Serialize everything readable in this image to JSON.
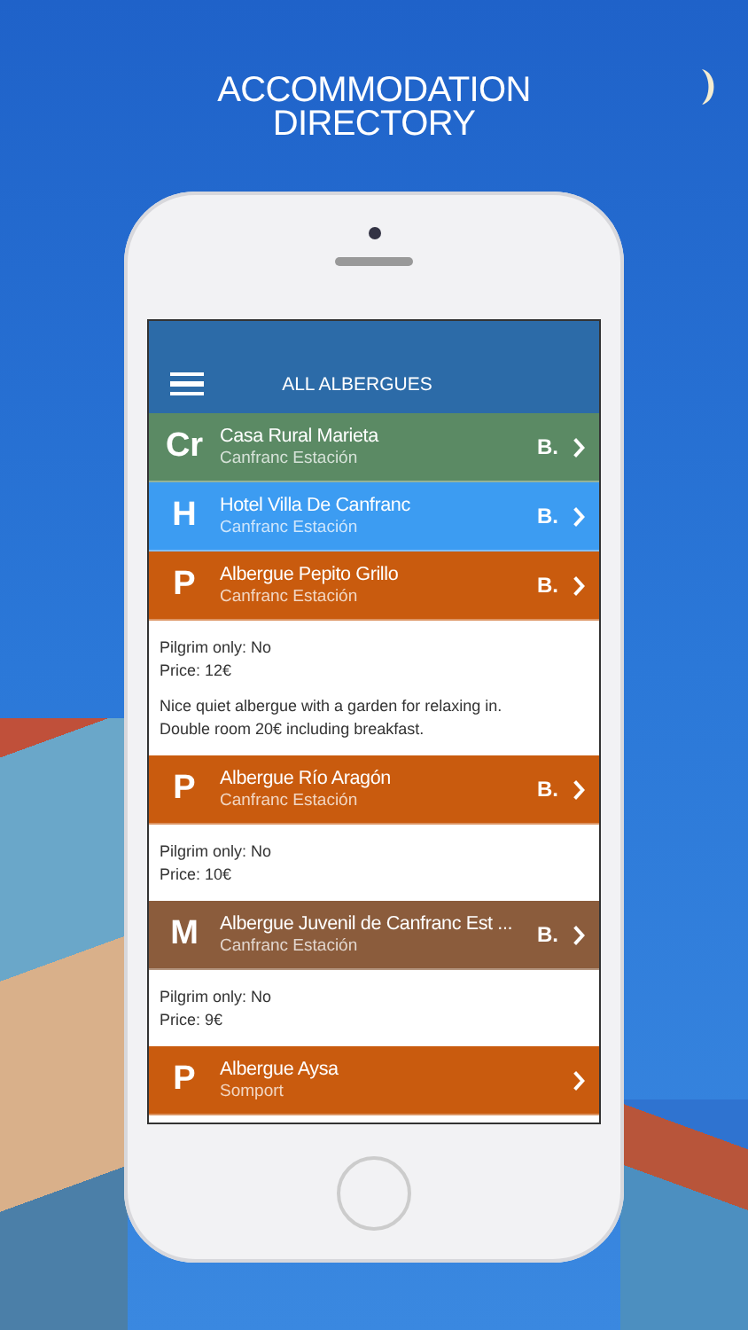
{
  "headline": [
    "ACCOMMODATION",
    "DIRECTORY"
  ],
  "app": {
    "title": "ALL ALBERGUES",
    "items": [
      {
        "badge": "Cr",
        "name": "Casa Rural Marieta",
        "place": "Canfranc Estación",
        "booking": "B.",
        "color": "#5b8a64"
      },
      {
        "badge": "H",
        "name": "Hotel Villa De Canfranc",
        "place": "Canfranc Estación",
        "booking": "B.",
        "color": "#3c9cf2"
      },
      {
        "badge": "P",
        "name": "Albergue Pepito Grillo",
        "place": "Canfranc Estación",
        "booking": "B.",
        "color": "#c95b0e",
        "details": [
          "Pilgrim only: No",
          "Price: 12€"
        ],
        "description": "Nice quiet albergue with a garden for relaxing in. Double room 20€ including breakfast."
      },
      {
        "badge": "P",
        "name": "Albergue Río Aragón",
        "place": "Canfranc Estación",
        "booking": "B.",
        "color": "#c95b0e",
        "details": [
          "Pilgrim only: No",
          "Price: 10€"
        ]
      },
      {
        "badge": "M",
        "name": "Albergue Juvenil de Canfranc Est ...",
        "place": "Canfranc Estación",
        "booking": "B.",
        "color": "#8b5c3c",
        "details": [
          "Pilgrim only: No",
          "Price: 9€"
        ]
      },
      {
        "badge": "P",
        "name": "Albergue Aysa",
        "place": "Somport",
        "color": "#c95b0e"
      }
    ]
  }
}
